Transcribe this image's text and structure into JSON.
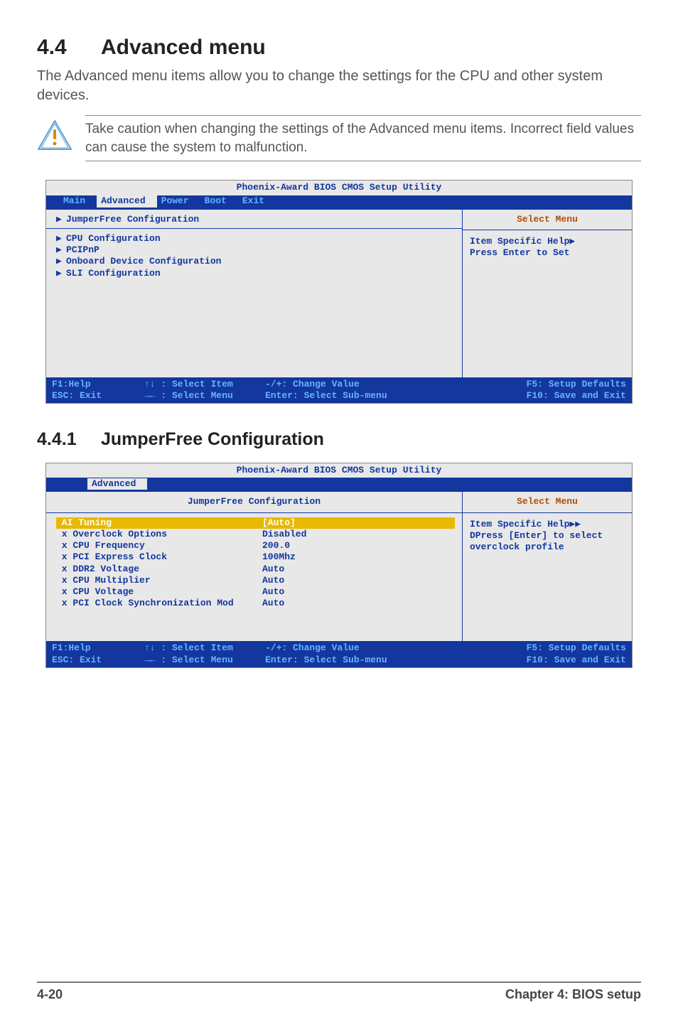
{
  "section": {
    "number": "4.4",
    "title": "Advanced menu"
  },
  "intro": "The Advanced menu items allow you to change the settings for the CPU and other system devices.",
  "note": "Take caution when changing the settings of the Advanced menu items. Incorrect field values can cause the system to malfunction.",
  "bios1": {
    "utility_title": "Phoenix-Award BIOS CMOS Setup Utility",
    "tabs": [
      "Main",
      "Advanced",
      "Power",
      "Boot",
      "Exit"
    ],
    "active_tab": "Advanced",
    "items_top": [
      "JumperFree Configuration"
    ],
    "items_rest": [
      "CPU Configuration",
      "PCIPnP",
      "Onboard Device Configuration",
      "SLI Configuration"
    ],
    "help_title": "Select Menu",
    "help_lines": [
      "Item Specific Help▶",
      "",
      "Press Enter to Set"
    ],
    "footer": {
      "f1": "F1:Help",
      "esc": "ESC: Exit",
      "sel_item": "↑↓ : Select Item",
      "sel_menu": "→← : Select Menu",
      "change": "-/+: Change Value",
      "enter": "Enter: Select Sub-menu",
      "f5": "F5: Setup Defaults",
      "f10": "F10: Save and Exit"
    }
  },
  "subsection": {
    "number": "4.4.1",
    "title": "JumperFree Configuration"
  },
  "bios2": {
    "utility_title": "Phoenix-Award BIOS CMOS Setup Utility",
    "tabs": [
      "Advanced"
    ],
    "panel_title": "JumperFree Configuration",
    "rows": [
      {
        "label": "AI Tuning",
        "value": "[Auto]",
        "selected": true
      },
      {
        "label": "x Overclock Options",
        "value": "Disabled"
      },
      {
        "label": "x CPU Frequency",
        "value": "200.0"
      },
      {
        "label": "x PCI Express Clock",
        "value": "100Mhz"
      },
      {
        "label": "x DDR2 Voltage",
        "value": "Auto"
      },
      {
        "label": "x CPU Multiplier",
        "value": "Auto"
      },
      {
        "label": "x CPU Voltage",
        "value": "Auto"
      },
      {
        "label": "x PCI Clock Synchronization Mod",
        "value": "Auto"
      }
    ],
    "help_title": "Select Menu",
    "help_lines": [
      "Item Specific Help▶▶",
      "",
      "DPress [Enter] to select overclock profile"
    ],
    "footer": {
      "f1": "F1:Help",
      "esc": "ESC: Exit",
      "sel_item": "↑↓ : Select Item",
      "sel_menu": "→← : Select Menu",
      "change": "-/+: Change Value",
      "enter": "Enter: Select Sub-menu",
      "f5": "F5: Setup Defaults",
      "f10": "F10: Save and Exit"
    }
  },
  "page": {
    "num": "4-20",
    "chapter": "Chapter 4: BIOS setup"
  }
}
